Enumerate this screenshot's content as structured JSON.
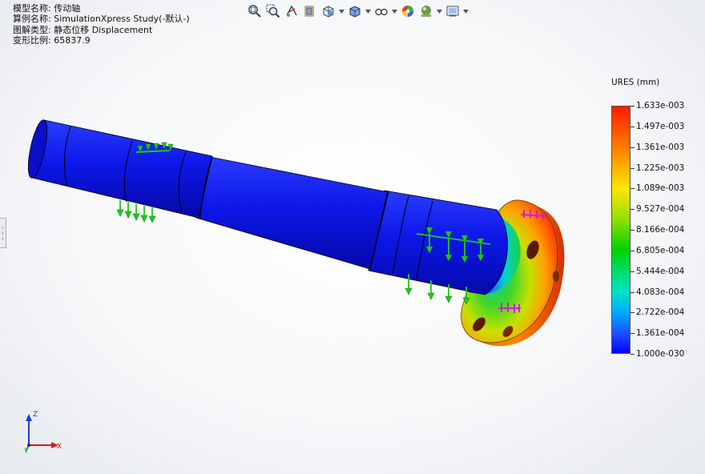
{
  "info": {
    "lines": [
      {
        "label": "模型名称:",
        "value": "传动轴"
      },
      {
        "label": "算例名称:",
        "value": "SimulationXpress Study(-默认-)"
      },
      {
        "label": "图解类型:",
        "value": "静态位移 Displacement"
      },
      {
        "label": "变形比例:",
        "value": "65837.9"
      }
    ]
  },
  "toolbar": {
    "buttons": [
      {
        "name": "zoom-to-fit-icon",
        "dropdown": false
      },
      {
        "name": "zoom-to-area-icon",
        "dropdown": false
      },
      {
        "name": "previous-view-icon",
        "dropdown": false
      },
      {
        "name": "section-view-icon",
        "dropdown": false
      },
      {
        "name": "view-orientation-icon",
        "dropdown": true
      },
      {
        "name": "display-style-icon",
        "dropdown": true
      },
      {
        "name": "hide-show-items-icon",
        "dropdown": true
      },
      {
        "name": "edit-appearance-icon",
        "dropdown": false
      },
      {
        "name": "apply-scene-icon",
        "dropdown": true
      },
      {
        "name": "view-settings-icon",
        "dropdown": true
      }
    ]
  },
  "legend": {
    "title": "URES (mm)",
    "labels": [
      "1.633e-003",
      "1.497e-003",
      "1.361e-003",
      "1.225e-003",
      "1.089e-003",
      "9.527e-004",
      "8.166e-004",
      "6.805e-004",
      "5.444e-004",
      "4.083e-004",
      "2.722e-004",
      "1.361e-004",
      "1.000e-030"
    ],
    "colors": {
      "max": "#ff1a00",
      "mid": "#00d200",
      "min": "#0000ff"
    }
  },
  "model": {
    "shaft_color": "#0a14e0",
    "fixture_color": "#22c81e",
    "load_color": "#d21ed2"
  },
  "triad": {
    "x": "X",
    "y": "Y",
    "z": "Z"
  }
}
